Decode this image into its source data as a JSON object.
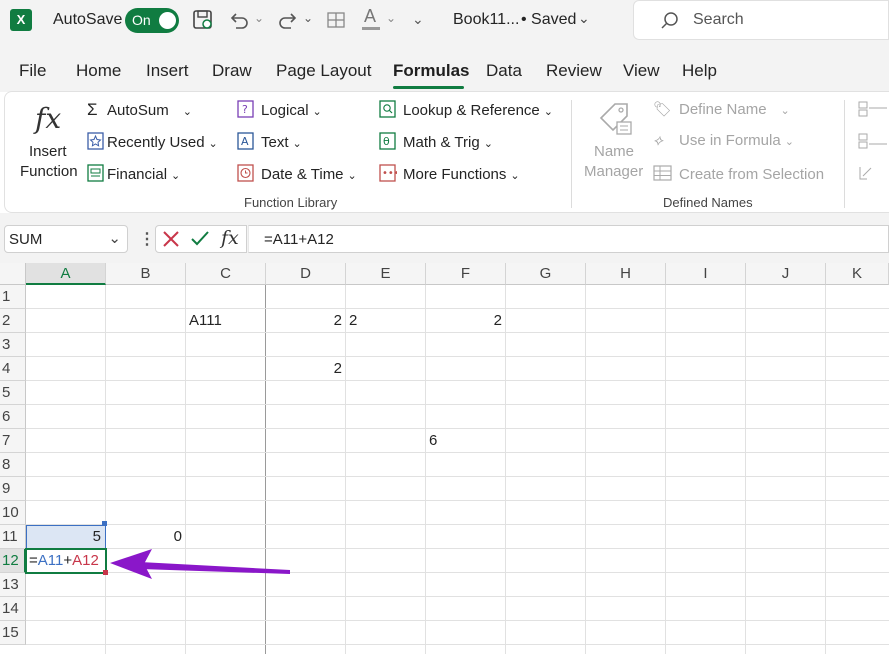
{
  "titlebar": {
    "autosave_label": "AutoSave",
    "toggle_label": "On",
    "doc_title": "Book11...",
    "save_status": "• Saved",
    "search_placeholder": "Search"
  },
  "menu": {
    "tabs": [
      "File",
      "Home",
      "Insert",
      "Draw",
      "Page Layout",
      "Formulas",
      "Data",
      "Review",
      "View",
      "Help"
    ],
    "active": "Formulas"
  },
  "ribbon": {
    "insert_function": [
      "Insert",
      "Function"
    ],
    "col1": [
      "AutoSum",
      "Recently Used",
      "Financial"
    ],
    "col2": [
      "Logical",
      "Text",
      "Date & Time"
    ],
    "col3": [
      "Lookup & Reference",
      "Math & Trig",
      "More Functions"
    ],
    "group1_label": "Function Library",
    "name_manager": [
      "Name",
      "Manager"
    ],
    "defined": [
      "Define Name",
      "Use in Formula",
      "Create from Selection"
    ],
    "group2_label": "Defined Names"
  },
  "formula_bar": {
    "name_box": "SUM",
    "fx": "fx",
    "formula": "=A11+A12"
  },
  "grid": {
    "columns": [
      "A",
      "B",
      "C",
      "D",
      "E",
      "F",
      "G",
      "H",
      "I",
      "J",
      "K"
    ],
    "rows": [
      "1",
      "2",
      "3",
      "4",
      "5",
      "6",
      "7",
      "8",
      "9",
      "10",
      "11",
      "12",
      "13",
      "14",
      "15"
    ],
    "cells": {
      "C2": "A111",
      "D2": "2",
      "E2": "2",
      "F2": "2",
      "D4": "2",
      "F7": "6",
      "A11": "5",
      "B11": "0"
    },
    "edit_cell": {
      "eq": "=",
      "ref1": "A11",
      "plus": "+",
      "ref2": "A12"
    }
  },
  "colors": {
    "excel_green": "#107c41",
    "ref1_blue": "#3c70c3",
    "ref2_red": "#c8364a",
    "arrow_purple": "#8a17c9"
  }
}
